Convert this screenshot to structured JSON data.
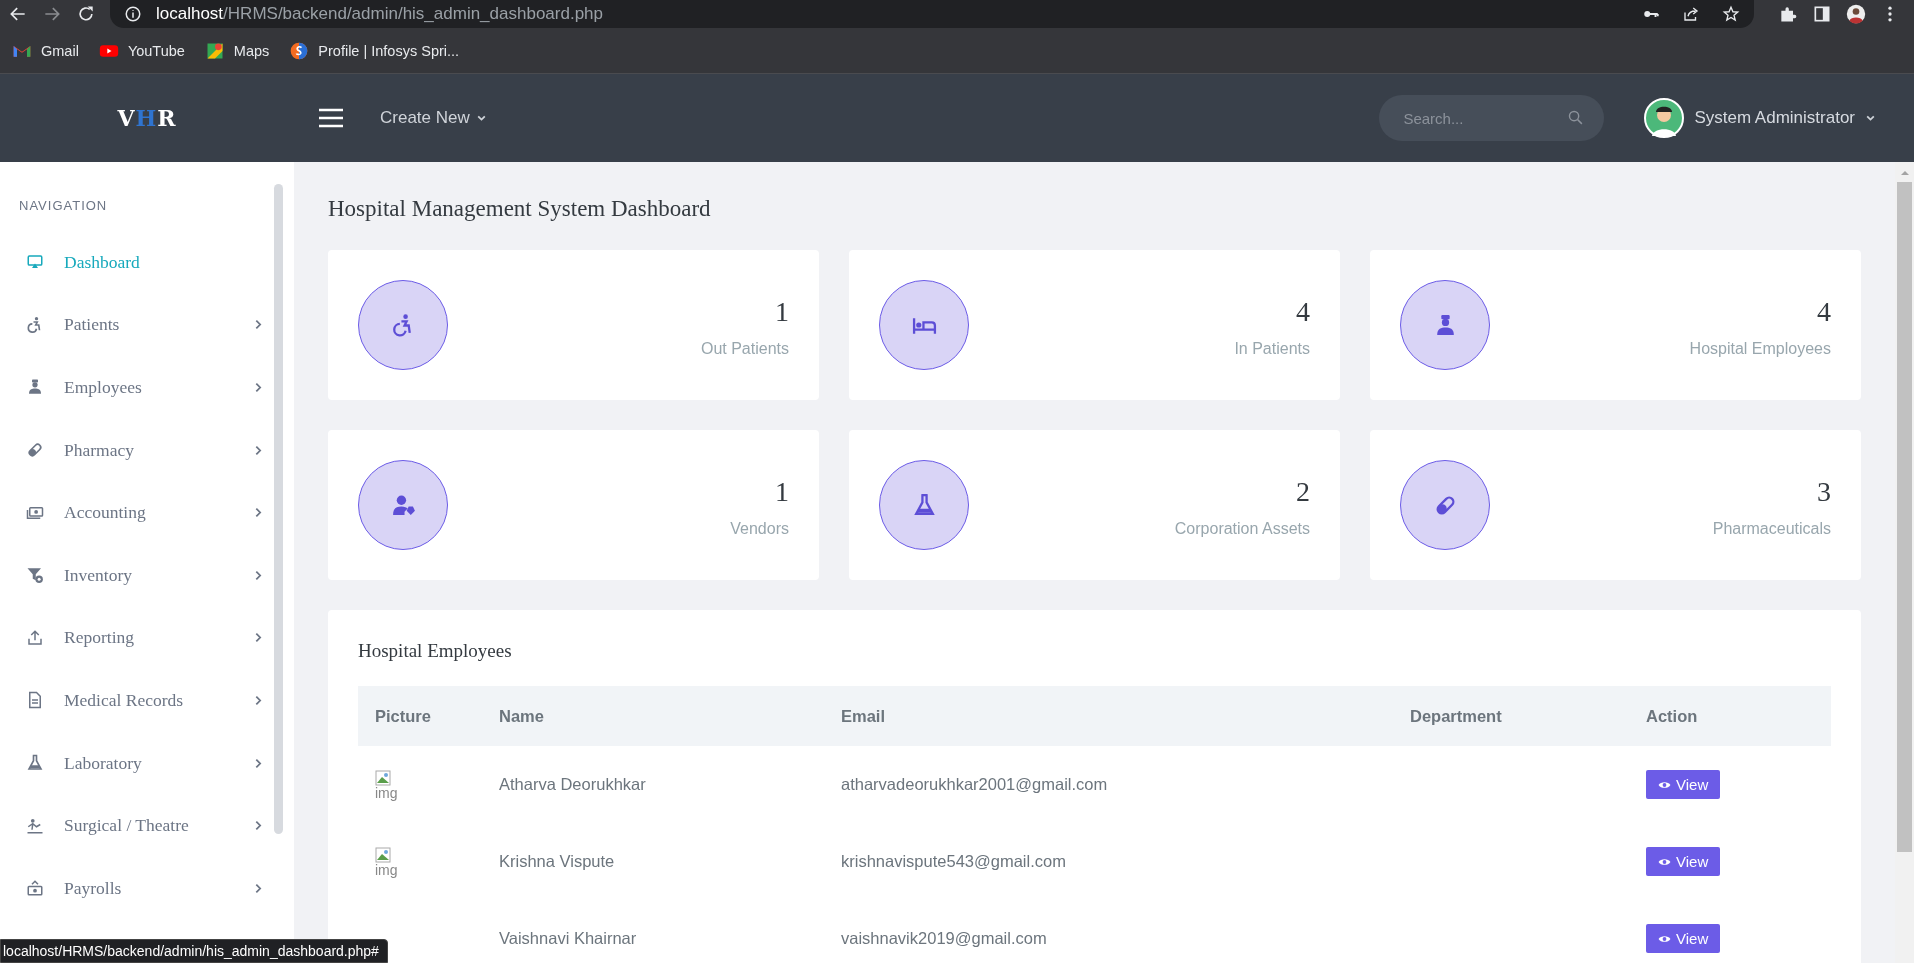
{
  "browser": {
    "url": {
      "host": "localhost",
      "path": "/HRMS/backend/admin/his_admin_dashboard.php"
    },
    "bookmarks": [
      {
        "kind": "gmail",
        "label": "Gmail"
      },
      {
        "kind": "youtube",
        "label": "YouTube"
      },
      {
        "kind": "maps",
        "label": "Maps"
      },
      {
        "kind": "profile",
        "label": "Profile | Infosys Spri..."
      }
    ],
    "status_url": "localhost/HRMS/backend/admin/his_admin_dashboard.php#"
  },
  "header": {
    "logo": "VHR",
    "create_new": "Create New",
    "search": {
      "placeholder": "Search..."
    },
    "user": "System Administrator"
  },
  "sidebar": {
    "heading": "NAVIGATION",
    "items": [
      {
        "label": "Dashboard",
        "selected": true,
        "expandable": false
      },
      {
        "label": "Patients",
        "selected": false,
        "expandable": true
      },
      {
        "label": "Employees",
        "selected": false,
        "expandable": true
      },
      {
        "label": "Pharmacy",
        "selected": false,
        "expandable": true
      },
      {
        "label": "Accounting",
        "selected": false,
        "expandable": true
      },
      {
        "label": "Inventory",
        "selected": false,
        "expandable": true
      },
      {
        "label": "Reporting",
        "selected": false,
        "expandable": true
      },
      {
        "label": "Medical Records",
        "selected": false,
        "expandable": true
      },
      {
        "label": "Laboratory",
        "selected": false,
        "expandable": true
      },
      {
        "label": "Surgical / Theatre",
        "selected": false,
        "expandable": true
      },
      {
        "label": "Payrolls",
        "selected": false,
        "expandable": true
      }
    ]
  },
  "page_title": "Hospital Management System Dashboard",
  "stats": [
    {
      "value": "1",
      "label": "Out Patients"
    },
    {
      "value": "4",
      "label": "In Patients"
    },
    {
      "value": "4",
      "label": "Hospital Employees"
    },
    {
      "value": "1",
      "label": "Vendors"
    },
    {
      "value": "2",
      "label": "Corporation Assets"
    },
    {
      "value": "3",
      "label": "Pharmaceuticals"
    }
  ],
  "employees": {
    "title": "Hospital Employees",
    "columns": [
      "Picture",
      "Name",
      "Email",
      "Department",
      "Action"
    ],
    "rows": [
      {
        "picture_alt": "img",
        "name": "Atharva Deorukhkar",
        "email": "atharvadeorukhkar2001@gmail.com",
        "action": "View"
      },
      {
        "picture_alt": "img",
        "name": "Krishna Vispute",
        "email": "krishnavispute543@gmail.com",
        "action": "View"
      },
      {
        "name": "Vaishnavi Khairnar",
        "email": "vaishnavik2019@gmail.com",
        "action": "View"
      }
    ]
  }
}
